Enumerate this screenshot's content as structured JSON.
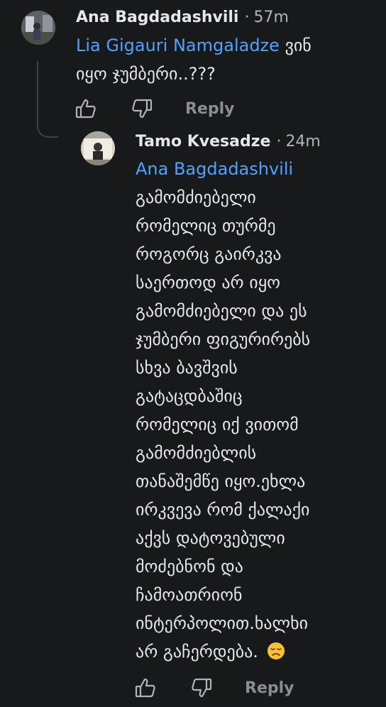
{
  "comment1": {
    "author": "Ana Bagdadashvili",
    "separator": "·",
    "time": "57m",
    "mention": "Lia Gigauri Namgaladze",
    "text_first": "ვინ",
    "text_lines": [
      "იყო ჯუმბერი..???"
    ],
    "reply_label": "Reply"
  },
  "comment2": {
    "author": "Tamo Kvesadze",
    "separator": "·",
    "time": "24m",
    "mention": "Ana Bagdadashvili",
    "text_lines": [
      "გამომძიებელი",
      "რომელიც თურმე",
      "როგორც გაირკვა",
      "საერთოდ არ იყო",
      "გამომძიებელი და ეს",
      "ჯუმბერი ფიგურირებს",
      "სხვა ბავშვის",
      "გატაცდბაშიც",
      "რომელიც იქ ვითომ",
      "გამომძიებლის",
      "თანაშემწე იყო.ეხლა",
      "ირკვევა რომ ქალაქი",
      "აქვს დატოვებული",
      "მოძებნონ და",
      "ჩამოათრიონ",
      "ინტერპოლით.ხალხი",
      "არ გაჩერდება."
    ],
    "emoji": "disappointed-face-emoji",
    "reply_label": "Reply"
  },
  "colors": {
    "background": "#18191a",
    "mention": "#4da3ff",
    "text": "#e4e6eb",
    "muted": "#b0b3b8"
  }
}
